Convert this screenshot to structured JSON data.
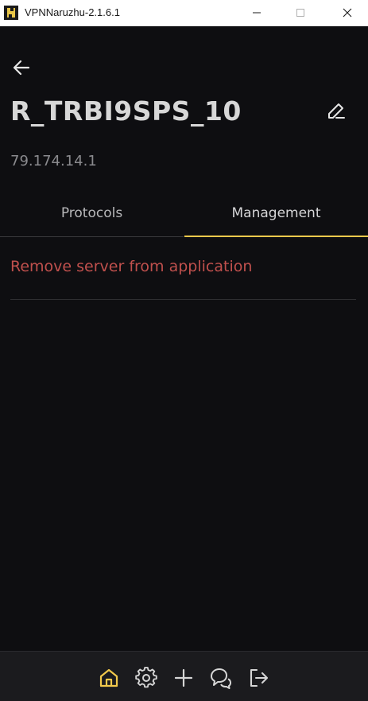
{
  "window": {
    "title": "VPNNaruzhu-2.1.6.1"
  },
  "server": {
    "name": "R_TRBI9SPS_10",
    "ip": "79.174.14.1"
  },
  "tabs": [
    {
      "label": "Protocols",
      "active": false
    },
    {
      "label": "Management",
      "active": true
    }
  ],
  "management": {
    "remove_label": "Remove server from application"
  },
  "bottom_nav": [
    {
      "icon": "home-icon",
      "active": true
    },
    {
      "icon": "gear-icon",
      "active": false
    },
    {
      "icon": "plus-icon",
      "active": false
    },
    {
      "icon": "chat-icon",
      "active": false
    },
    {
      "icon": "exit-icon",
      "active": false
    }
  ],
  "colors": {
    "background": "#0e0e11",
    "accent": "#f2c94c",
    "danger": "#c0504d",
    "bottom_bar": "#1b1b1e"
  }
}
